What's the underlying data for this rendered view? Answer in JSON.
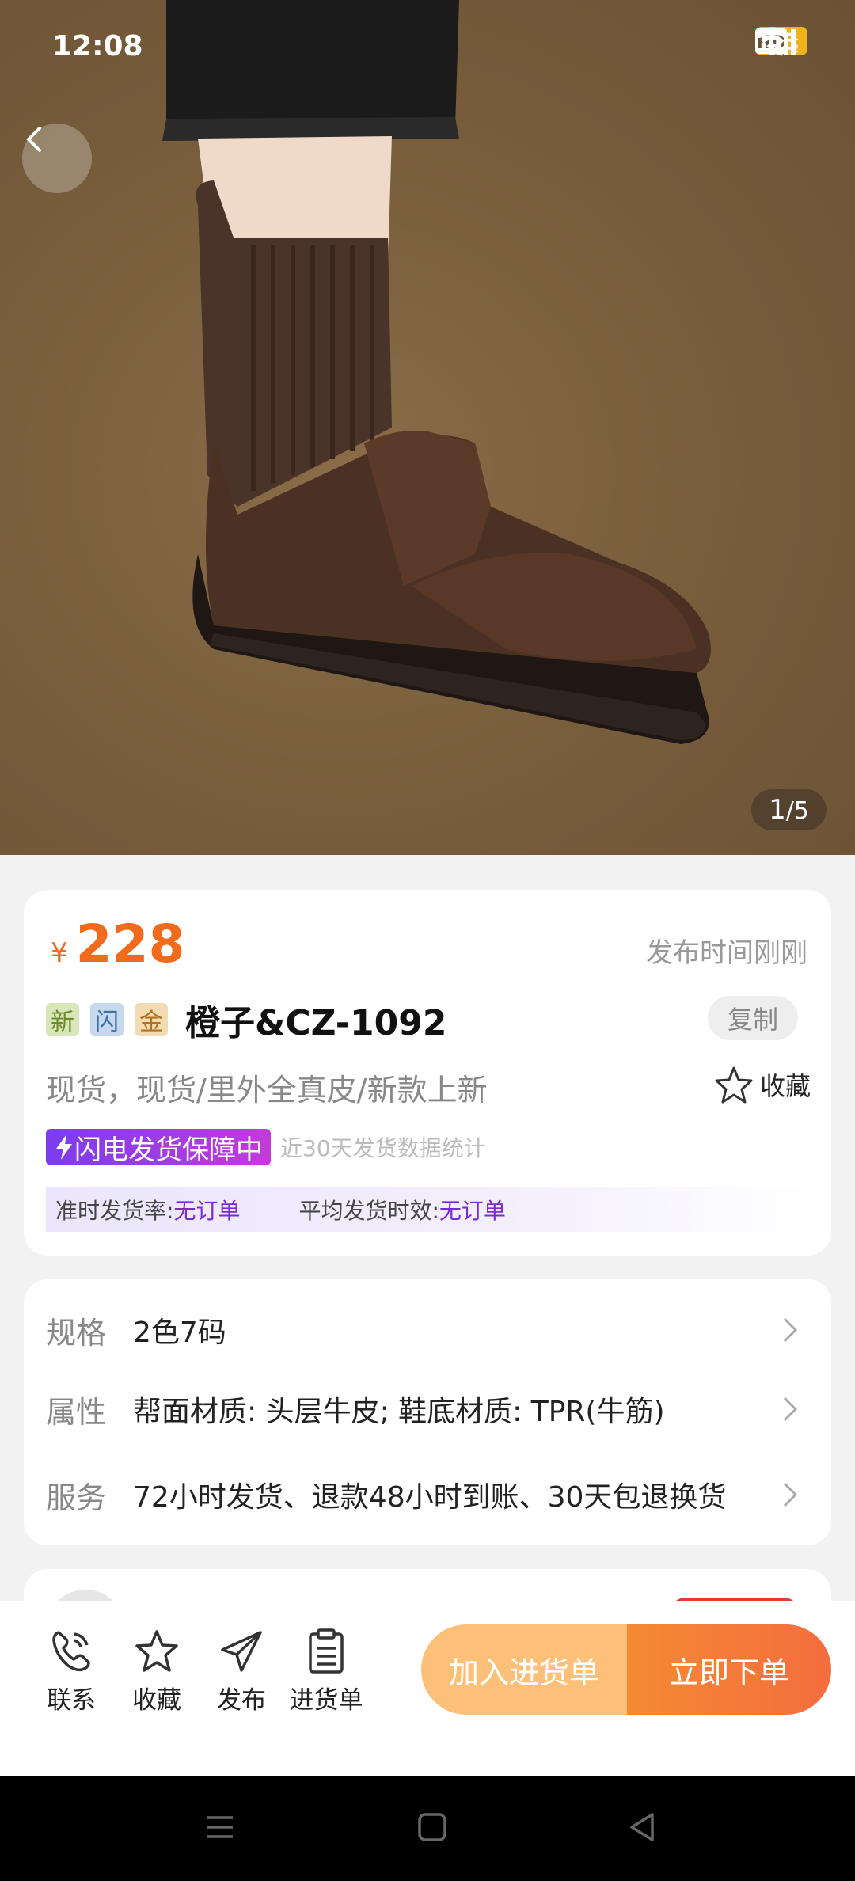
{
  "status_bar": {
    "time": "12:08",
    "battery": "66"
  },
  "gallery": {
    "current": "1",
    "total": "/5"
  },
  "product": {
    "currency": "¥",
    "price": "228",
    "publish_time": "发布时间刚刚",
    "tags": [
      "新",
      "闪",
      "金"
    ],
    "title": "橙子&CZ-1092",
    "copy_label": "复制",
    "subtitle": "现货，现货/里外全真皮/新款上新",
    "favorite_label": "收藏",
    "guarantee_badge": "闪电发货保障中",
    "guarantee_note": "近30天发货数据统计",
    "stats": {
      "ontime_label": "准时发货率:",
      "ontime_value": "无订单",
      "avg_label": "平均发货时效:",
      "avg_value": "无订单"
    }
  },
  "specs": [
    {
      "label": "规格",
      "value": "2色7码"
    },
    {
      "label": "属性",
      "value": "帮面材质: 头层牛皮; 鞋底材质: TPR(牛筋)"
    },
    {
      "label": "服务",
      "value": "72小时发货、退款48小时到账、30天包退换货"
    }
  ],
  "actions": {
    "contact": "联系",
    "favorite": "收藏",
    "publish": "发布",
    "cart_list": "进货单",
    "add_to_cart": "加入进货单",
    "buy_now": "立即下单"
  },
  "colors": {
    "price_orange": "#f26b1d",
    "guarantee_purple": "#7b3cf0",
    "buy_orange": "#f46d3e",
    "cart_orange": "#fcc078"
  }
}
